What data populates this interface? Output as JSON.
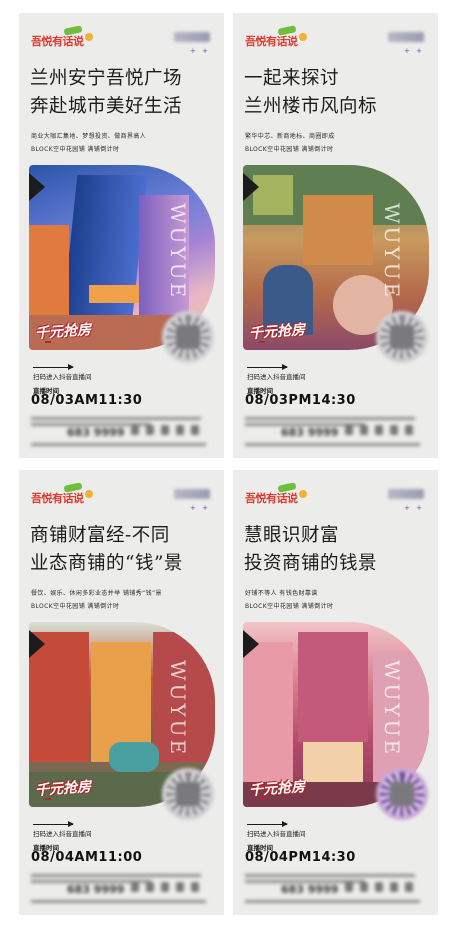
{
  "logo": "吾悦有话说",
  "cards": [
    {
      "title1": "兰州安宁吾悦广场",
      "title2": "奔赴城市美好生活",
      "sub1": "商业大咖汇集地、梦想投资、做商界高人",
      "sub2": "BLOCK空中花园铺  满铺倒计时",
      "slogan": "千元抢房",
      "scan": "扫码进入抖音直播间",
      "live_label": "直播时间",
      "live_time": "08/03AM11:30",
      "phone": "683 9999"
    },
    {
      "title1": "一起来探讨",
      "title2": "兰州楼市风向标",
      "sub1": "繁华中芯、新商地标、商圈即成",
      "sub2": "BLOCK空中花园铺  满铺倒计时",
      "slogan": "千元抢房",
      "scan": "扫码进入抖音直播间",
      "live_label": "直播时间",
      "live_time": "08/03PM14:30",
      "phone": "683 9999"
    },
    {
      "title1": "商铺财富经-不同",
      "title2": "业态商铺的“钱”景",
      "sub1": "餐饮、娱乐、休闲多彩业态并举  铺铺秀“钱”景",
      "sub2": "BLOCK空中花园铺  满铺倒计时",
      "slogan": "千元抢房",
      "scan": "扫码进入抖音直播间",
      "live_label": "直播时间",
      "live_time": "08/04AM11:00",
      "phone": "683 9999"
    },
    {
      "title1": "慧眼识财富",
      "title2": "投资商铺的钱景",
      "sub1": "好铺不等人  有钱色财靠谱",
      "sub2": "BLOCK空中花园铺  满铺倒计时",
      "slogan": "千元抢房",
      "scan": "扫码进入抖音直播间",
      "live_label": "直播时间",
      "live_time": "08/04PM14:30",
      "phone": "683 9999"
    }
  ],
  "watermark": "WUYUE",
  "plus_marks": "+ +",
  "colors": {
    "logo_red": "#e03a2e",
    "bg": "#ececea",
    "slogan_red": "#b3262a"
  }
}
